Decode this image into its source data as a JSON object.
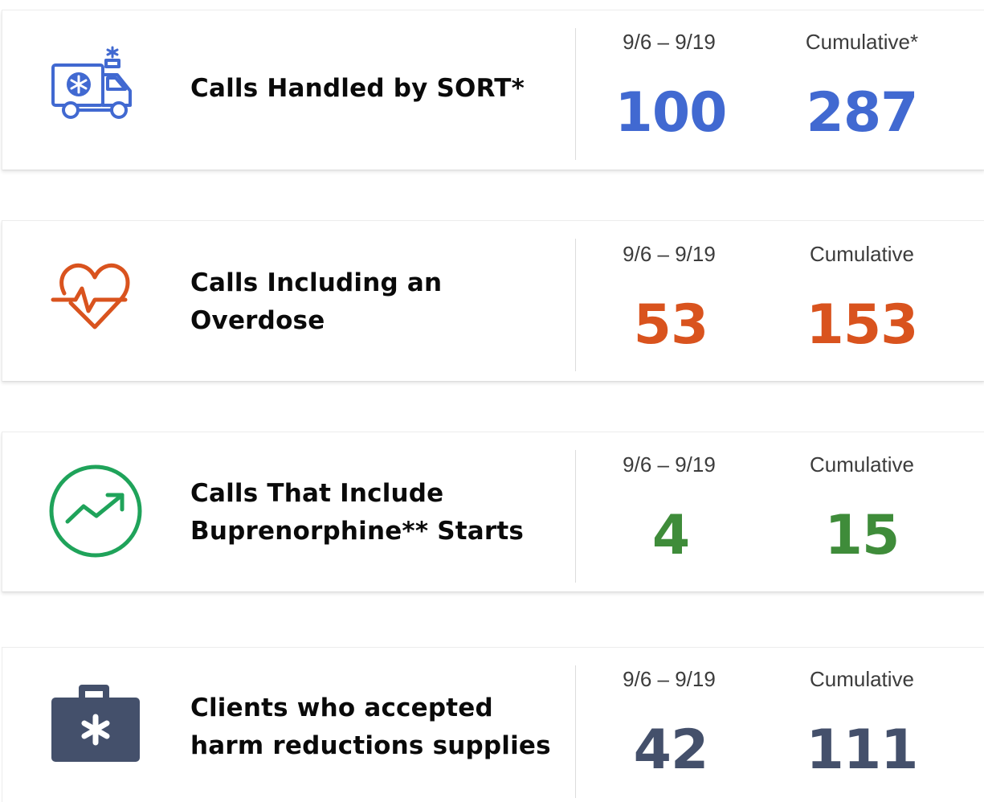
{
  "cards": [
    {
      "icon": "ambulance-icon",
      "label_lines": [
        "Calls Handled by SORT*"
      ],
      "period_label": "9/6 – 9/19",
      "period_value": "100",
      "cumulative_label": "Cumulative*",
      "cumulative_value": "287",
      "color": "#4169d1"
    },
    {
      "icon": "heartbeat-icon",
      "label_lines": [
        "Calls Including an",
        "Overdose"
      ],
      "period_label": "9/6 – 9/19",
      "period_value": "53",
      "cumulative_label": "Cumulative",
      "cumulative_value": "153",
      "color": "#d9531e"
    },
    {
      "icon": "trending-up-icon",
      "label_lines": [
        "Calls That Include",
        "Buprenorphine** Starts"
      ],
      "period_label": "9/6 – 9/19",
      "period_value": "4",
      "cumulative_label": "Cumulative",
      "cumulative_value": "15",
      "color": "#3f8c3a"
    },
    {
      "icon": "medical-kit-icon",
      "label_lines": [
        "Clients who accepted",
        "harm reductions supplies"
      ],
      "period_label": "9/6 – 9/19",
      "period_value": "42",
      "cumulative_label": "Cumulative",
      "cumulative_value": "111",
      "color": "#44506b"
    }
  ]
}
